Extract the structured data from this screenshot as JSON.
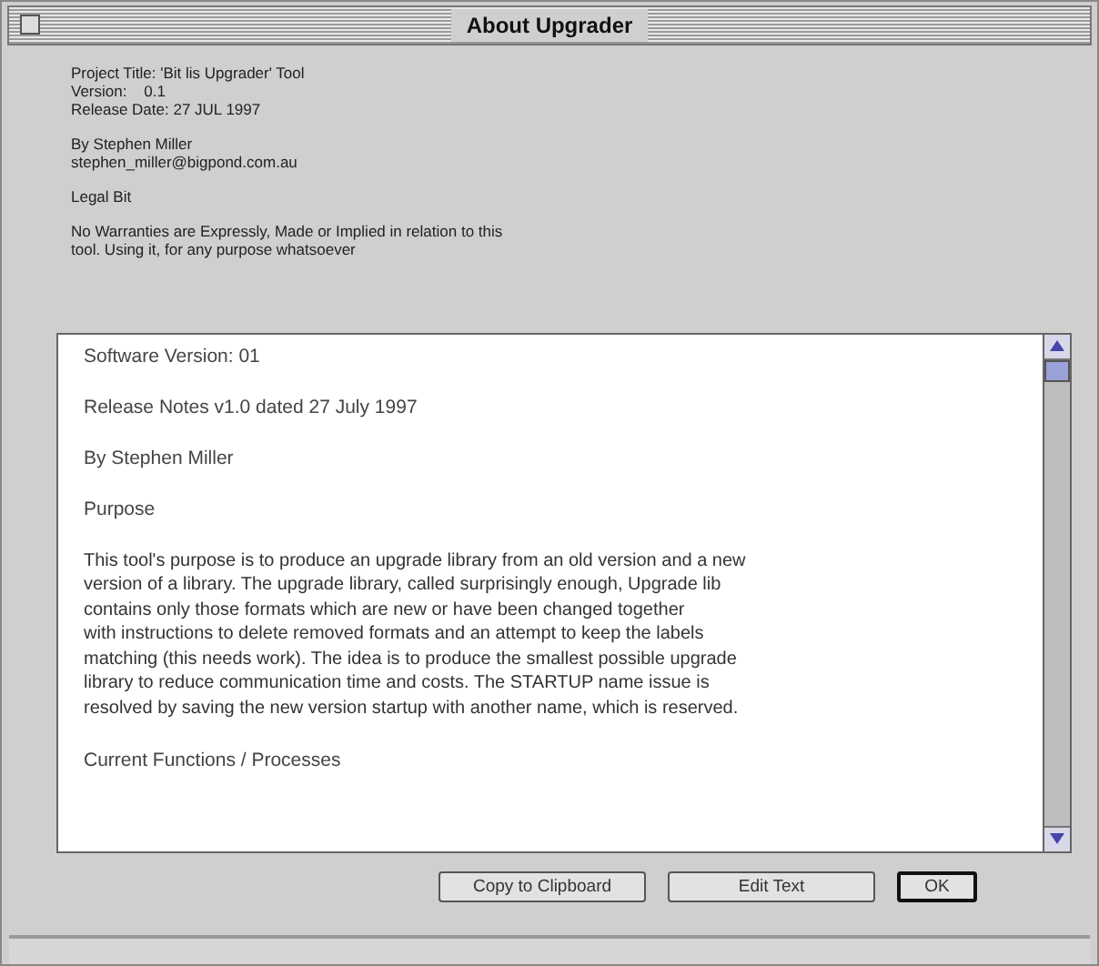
{
  "window": {
    "title": "About Upgrader"
  },
  "header": {
    "lines": [
      "Project Title: 'Bit lis Upgrader' Tool",
      "Version:    0.1",
      "Release Date: 27 JUL 1997"
    ],
    "author": [
      "By Stephen Miller",
      "stephen_miller@bigpond.com.au"
    ],
    "legal_title": "Legal Bit",
    "legal_text": [
      "No Warranties are Expressly, Made or Implied in relation to this",
      "tool. Using it, for any purpose whatsoever"
    ]
  },
  "notes": {
    "blocks": [
      {
        "kind": "line",
        "text": "Software Version: 01"
      },
      {
        "kind": "line",
        "text": "Release Notes v1.0 dated 27 July 1997"
      },
      {
        "kind": "line",
        "text": "By Stephen Miller"
      },
      {
        "kind": "line",
        "text": "Purpose"
      },
      {
        "kind": "paragraph",
        "text": "This tool's purpose is to produce an upgrade library from an old version and a new\nversion of a library. The upgrade library, called surprisingly enough, Upgrade lib\ncontains only those formats which are new or have been changed together\nwith instructions to delete removed formats and an attempt to keep the labels\nmatching (this needs work). The idea is to produce the smallest possible upgrade\nlibrary to reduce communication time and costs. The STARTUP name issue is\nresolved by saving the new version startup with another name, which is reserved."
      },
      {
        "kind": "line",
        "text": "Current Functions / Processes"
      }
    ]
  },
  "buttons": [
    {
      "label": "Copy to Clipboard",
      "default": false
    },
    {
      "label": "Edit Text",
      "default": false
    },
    {
      "label": "OK",
      "default": true
    }
  ]
}
